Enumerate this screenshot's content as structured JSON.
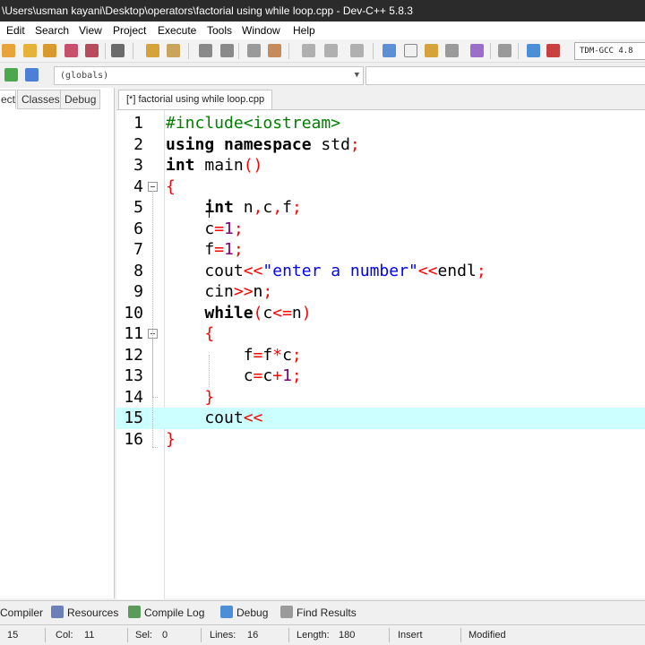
{
  "window": {
    "title": "\\Users\\usman kayani\\Desktop\\operators\\factorial using while loop.cpp - Dev-C++ 5.8.3"
  },
  "menu": [
    "Edit",
    "Search",
    "View",
    "Project",
    "Execute",
    "Tools",
    "Window",
    "Help"
  ],
  "toolbar": {
    "compiler": "TDM-GCC 4.8"
  },
  "scope": {
    "value": "(globals)"
  },
  "left_tabs": [
    "ect",
    "Classes",
    "Debug"
  ],
  "file_tab": {
    "label": "[*] factorial using while loop.cpp"
  },
  "editor": {
    "line_numbers": [
      "1",
      "2",
      "3",
      "4",
      "5",
      "6",
      "7",
      "8",
      "9",
      "10",
      "11",
      "12",
      "13",
      "14",
      "15",
      "16"
    ],
    "current_line": 15,
    "lines": [
      "#include<iostream>",
      "using namespace std;",
      "int main()",
      "{",
      "    int n,c,f;",
      "    c=1;",
      "    f=1;",
      "    cout<<\"enter a number\"<<endl;",
      "    cin>>n;",
      "    while(c<=n)",
      "    {",
      "        f=f*c;",
      "        c=c+1;",
      "    }",
      "    cout<<",
      "}"
    ]
  },
  "bottom_tabs": [
    "Compiler",
    "Resources",
    "Compile Log",
    "Debug",
    "Find Results"
  ],
  "status": {
    "line": "15",
    "col_label": "Col:",
    "col": "11",
    "sel_label": "Sel:",
    "sel": "0",
    "lines_label": "Lines:",
    "lines": "16",
    "length_label": "Length:",
    "length": "180",
    "mode": "Insert",
    "state": "Modified"
  },
  "colors": {
    "current_line": "#ccffff",
    "preprocessor": "#008000",
    "symbol": "#ff0000",
    "string": "#0000ff",
    "number": "#800080"
  }
}
